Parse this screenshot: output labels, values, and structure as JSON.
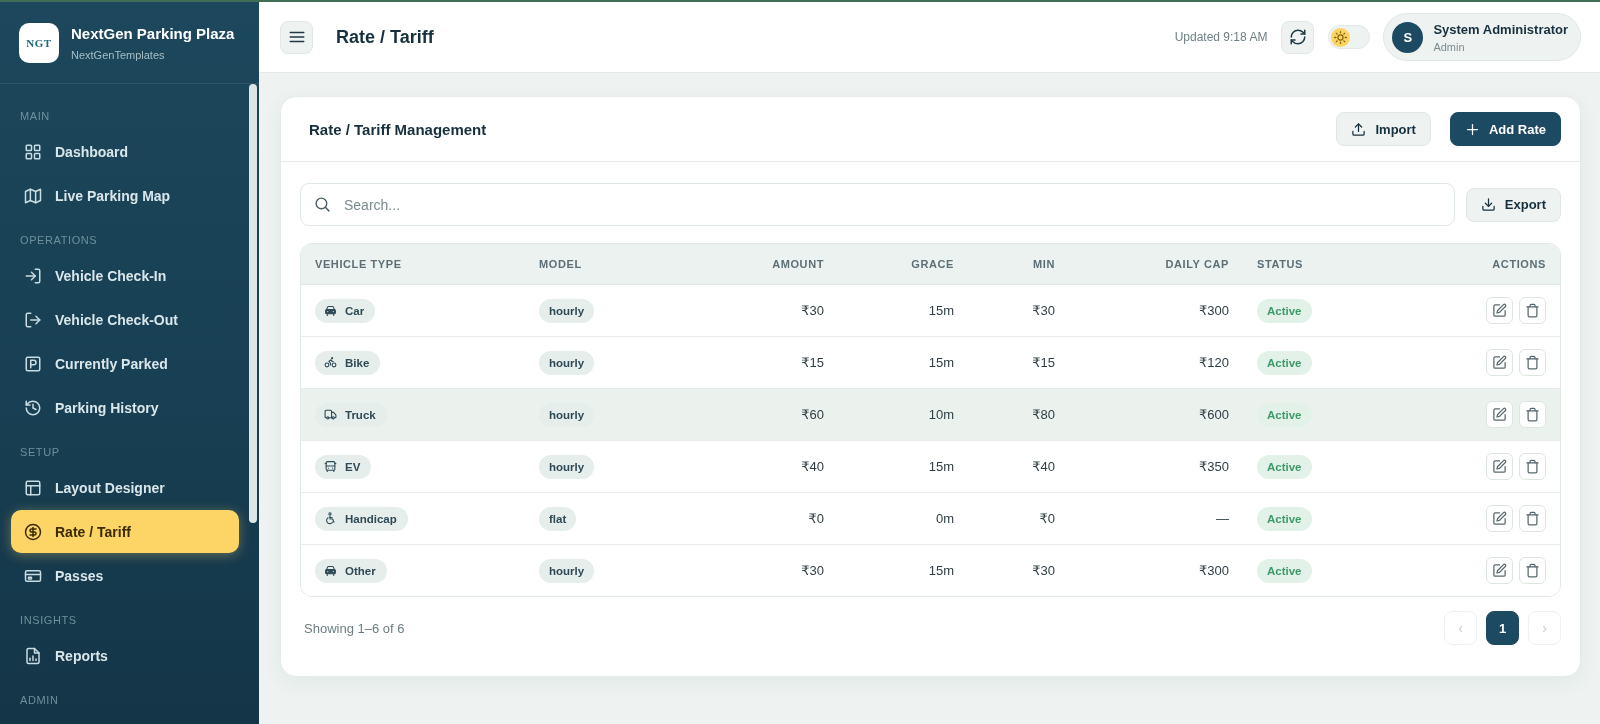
{
  "sidebar": {
    "brand": {
      "logo_text": "NGT",
      "title": "NextGen Parking Plaza",
      "subtitle": "NextGenTemplates"
    },
    "sections": [
      {
        "label": "MAIN",
        "items": [
          {
            "label": "Dashboard",
            "kind": "grid",
            "selected": false
          },
          {
            "label": "Live Parking Map",
            "kind": "map",
            "selected": false
          }
        ]
      },
      {
        "label": "OPERATIONS",
        "items": [
          {
            "label": "Vehicle Check-In",
            "kind": "login",
            "selected": false
          },
          {
            "label": "Vehicle Check-Out",
            "kind": "logout",
            "selected": false
          },
          {
            "label": "Currently Parked",
            "kind": "parking",
            "selected": false
          },
          {
            "label": "Parking History",
            "kind": "history",
            "selected": false
          }
        ]
      },
      {
        "label": "SETUP",
        "items": [
          {
            "label": "Layout Designer",
            "kind": "layout",
            "selected": false
          },
          {
            "label": "Rate / Tariff",
            "kind": "dollar",
            "selected": true
          },
          {
            "label": "Passes",
            "kind": "card",
            "selected": false
          }
        ]
      },
      {
        "label": "INSIGHTS",
        "items": [
          {
            "label": "Reports",
            "kind": "report",
            "selected": false
          }
        ]
      },
      {
        "label": "ADMIN"
      }
    ]
  },
  "header": {
    "title": "Rate / Tariff",
    "updated": "Updated 9:18 AM",
    "theme_toggle": {
      "on": false
    },
    "user": {
      "initial": "S",
      "name": "System Administrator",
      "role": "Admin"
    }
  },
  "card": {
    "title": "Rate / Tariff Management",
    "actions": [
      {
        "label": "Import",
        "kind": "upload"
      },
      {
        "label": "Add Rate",
        "kind": "add"
      }
    ],
    "search": {
      "placeholder": "Search..."
    },
    "export_button": {
      "label": "Export"
    }
  },
  "table": {
    "columns": [
      "VEHICLE TYPE",
      "MODEL",
      "AMOUNT",
      "GRACE",
      "MIN",
      "DAILY CAP",
      "STATUS",
      "ACTIONS"
    ],
    "rows": [
      {
        "vehicle": {
          "label": "Car",
          "kind": "car"
        },
        "model": "hourly",
        "amount": "₹30",
        "grace": "15m",
        "min": "₹30",
        "daily_cap": "₹300",
        "status": "Active",
        "hovered": false
      },
      {
        "vehicle": {
          "label": "Bike",
          "kind": "bike"
        },
        "model": "hourly",
        "amount": "₹15",
        "grace": "15m",
        "min": "₹15",
        "daily_cap": "₹120",
        "status": "Active",
        "hovered": false
      },
      {
        "vehicle": {
          "label": "Truck",
          "kind": "truck"
        },
        "model": "hourly",
        "amount": "₹60",
        "grace": "10m",
        "min": "₹80",
        "daily_cap": "₹600",
        "status": "Active",
        "hovered": true
      },
      {
        "vehicle": {
          "label": "EV",
          "kind": "bus"
        },
        "model": "hourly",
        "amount": "₹40",
        "grace": "15m",
        "min": "₹40",
        "daily_cap": "₹350",
        "status": "Active",
        "hovered": false
      },
      {
        "vehicle": {
          "label": "Handicap",
          "kind": "accessible"
        },
        "model": "flat",
        "amount": "₹0",
        "grace": "0m",
        "min": "₹0",
        "daily_cap": "—",
        "status": "Active",
        "hovered": false
      },
      {
        "vehicle": {
          "label": "Other",
          "kind": "car"
        },
        "model": "hourly",
        "amount": "₹30",
        "grace": "15m",
        "min": "₹30",
        "daily_cap": "₹300",
        "status": "Active",
        "hovered": false
      }
    ]
  },
  "footer": {
    "summary": "Showing 1–6 of 6",
    "pagination": {
      "prev": {
        "label": "‹",
        "disabled": true
      },
      "pages": [
        {
          "label": "1",
          "selected": true
        }
      ],
      "next": {
        "label": "›",
        "disabled": true
      }
    }
  }
}
